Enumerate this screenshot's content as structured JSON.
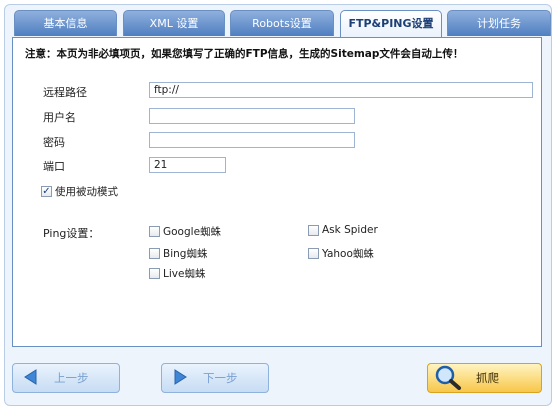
{
  "tabs": [
    {
      "label": "基本信息",
      "active": false
    },
    {
      "label": "XML 设置",
      "active": false
    },
    {
      "label": "Robots设置",
      "active": false
    },
    {
      "label": "FTP&PING设置",
      "active": true
    },
    {
      "label": "计划任务",
      "active": false
    }
  ],
  "notice": "注意：本页为非必填项页，如果您填写了正确的FTP信息，生成的Sitemap文件会自动上传！",
  "form": {
    "remote_path_label": "远程路径",
    "remote_path_value": "ftp://",
    "username_label": "用户名",
    "username_value": "",
    "password_label": "密码",
    "password_value": "",
    "port_label": "端口",
    "port_value": "21",
    "passive_label": "使用被动模式",
    "passive_checked": true
  },
  "ping": {
    "label": "Ping设置：",
    "options": [
      {
        "label": "Google蜘蛛",
        "checked": false
      },
      {
        "label": "Ask Spider",
        "checked": false
      },
      {
        "label": "Bing蜘蛛",
        "checked": false
      },
      {
        "label": "Yahoo蜘蛛",
        "checked": false
      },
      {
        "label": "Live蜘蛛",
        "checked": false
      }
    ]
  },
  "buttons": {
    "prev_label": "上一步",
    "next_label": "下一步",
    "crawl_label": "抓爬"
  },
  "icons": {
    "prev": "arrow-left-icon",
    "next": "arrow-right-icon",
    "crawl": "magnifier-icon"
  }
}
